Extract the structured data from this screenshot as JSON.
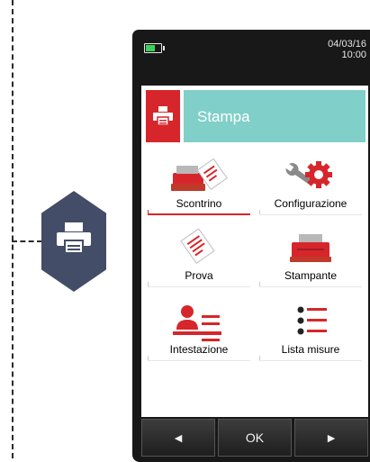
{
  "status": {
    "date": "04/03/16",
    "time": "10:00"
  },
  "header": {
    "title": "Stampa",
    "icon": "printer-icon"
  },
  "menu": [
    {
      "label": "Scontrino",
      "icon": "receipt-icon",
      "selected": true
    },
    {
      "label": "Configurazione",
      "icon": "gear-wrench-icon",
      "selected": false
    },
    {
      "label": "Prova",
      "icon": "test-ticket-icon",
      "selected": false
    },
    {
      "label": "Stampante",
      "icon": "printer-icon",
      "selected": false
    },
    {
      "label": "Intestazione",
      "icon": "person-header-icon",
      "selected": false
    },
    {
      "label": "Lista misure",
      "icon": "list-icon",
      "selected": false
    }
  ],
  "softkeys": {
    "left": "◄",
    "ok": "OK",
    "right": "►"
  },
  "colors": {
    "accent": "#d6262b",
    "header_bg": "#80cfc8",
    "hex": "#434d68",
    "device": "#181818"
  }
}
